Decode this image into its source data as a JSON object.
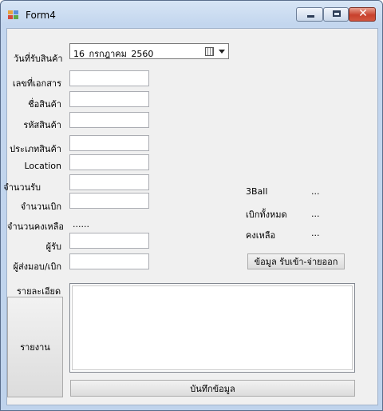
{
  "window": {
    "title": "Form4"
  },
  "form": {
    "receive_date_label": "วันที่รับสินค้า",
    "receive_date_value": "16  กรกฎาคม    2560",
    "doc_no_label": "เลขที่เอกสาร",
    "product_name_label": "ชื่อสินค้า",
    "product_code_label": "รหัสสินค้า",
    "product_type_label": "ประเภทสินค้า",
    "location_label": "Location",
    "receive_qty_label": "จำนวนรับ",
    "withdraw_qty_label": "จำนวนเบิก",
    "remaining_qty_label": "จำนวนคงเหลือ",
    "remaining_qty_value": "......",
    "receiver_label": "ผู้รับ",
    "sender_label": "ผู้ส่งมอบ/เบิก",
    "details_label": "รายละเอียด"
  },
  "summary": {
    "item_name": "3Ball",
    "item_value": "...",
    "total_withdraw_label": "เบิกทั้งหมด",
    "total_withdraw_value": "...",
    "remaining_label": "คงเหลือ",
    "remaining_value": "...",
    "inout_button": "ข้อมูล รับเข้า-จ่ายออก"
  },
  "buttons": {
    "report": "รายงาน",
    "save": "บันทึกข้อมูล"
  }
}
